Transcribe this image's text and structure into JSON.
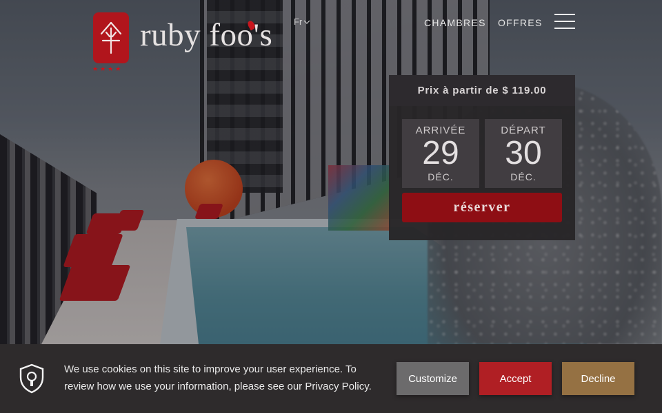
{
  "header": {
    "brand": "ruby foo's",
    "stars": "★★★★",
    "language": "Fr",
    "nav": {
      "rooms": "CHAMBRES",
      "offers": "OFFRES"
    }
  },
  "booking": {
    "price_text": "Prix à partir de $ 119.00",
    "arrival": {
      "label": "ARRIVÉE",
      "day": "29",
      "month": "DÉC."
    },
    "departure": {
      "label": "DÉPART",
      "day": "30",
      "month": "DÉC."
    },
    "reserve_label": "réserver"
  },
  "cookie_bar": {
    "message": "We use cookies on this site to improve your user experience. To review how we use your information, please see our Privacy Policy.",
    "customize_label": "Customize",
    "accept_label": "Accept",
    "decline_label": "Decline"
  },
  "colors": {
    "brand_red": "#b1151c",
    "reserve_red": "#8e0e14",
    "accept_red": "#b01f24",
    "decline_gold": "#957143",
    "customize_grey": "#6c6b6c",
    "panel_dark": "#2e2b2c"
  },
  "icons": {
    "logo": "umbrella-character-logo",
    "language_dropdown": "chevron-down-icon",
    "menu": "hamburger-menu-icon",
    "cookie": "shield-lock-icon"
  }
}
